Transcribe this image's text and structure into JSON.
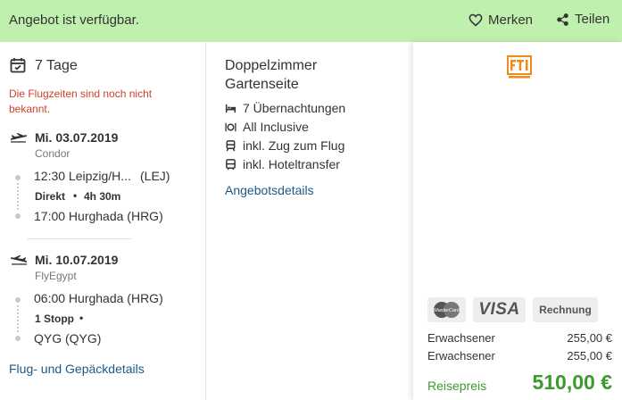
{
  "header": {
    "availability": "Angebot ist verfügbar.",
    "merken_label": "Merken",
    "teilen_label": "Teilen"
  },
  "flight": {
    "duration_title": "7 Tage",
    "warning": [
      "Die Flugzeiten sind noch nicht",
      "bekannt."
    ],
    "outbound": {
      "date": "Mi. 03.07.2019",
      "airline": "Condor",
      "departure": "12:30 Leipzig/H...",
      "departure_code": "(LEJ)",
      "stops": "Direkt",
      "flight_time": "4h 30m",
      "arrival": "17:00 Hurghada (HRG)"
    },
    "return": {
      "date": "Mi. 10.07.2019",
      "airline": "FlyEgypt",
      "departure": "06:00 Hurghada (HRG)",
      "stops": "1 Stopp",
      "arrival": "QYG (QYG)"
    },
    "details_link": "Flug- und Gepäckdetails"
  },
  "room": {
    "title_line1": "Doppelzimmer",
    "title_line2": "Gartenseite",
    "features": [
      {
        "icon": "bed-icon",
        "label": "7 Übernachtungen"
      },
      {
        "icon": "cutlery-icon",
        "label": "All Inclusive"
      },
      {
        "icon": "train-icon",
        "label": "inkl. Zug zum Flug"
      },
      {
        "icon": "bus-icon",
        "label": "inkl. Hoteltransfer"
      }
    ],
    "details_link": "Angebotsdetails"
  },
  "pricing": {
    "logo_text": "FTI",
    "payment_methods": [
      "MasterCard",
      "VISA",
      "Rechnung"
    ],
    "rows": [
      {
        "label": "Erwachsener",
        "price": "255,00 €"
      },
      {
        "label": "Erwachsener",
        "price": "255,00 €"
      }
    ],
    "total_label": "Reisepreis",
    "total_price": "510,00 €"
  },
  "colors": {
    "banner": "#bff0ad",
    "price_green": "#3c9a2e",
    "link": "#1a5a8c",
    "warning": "#d0402c",
    "fti_orange": "#f08a1c"
  }
}
